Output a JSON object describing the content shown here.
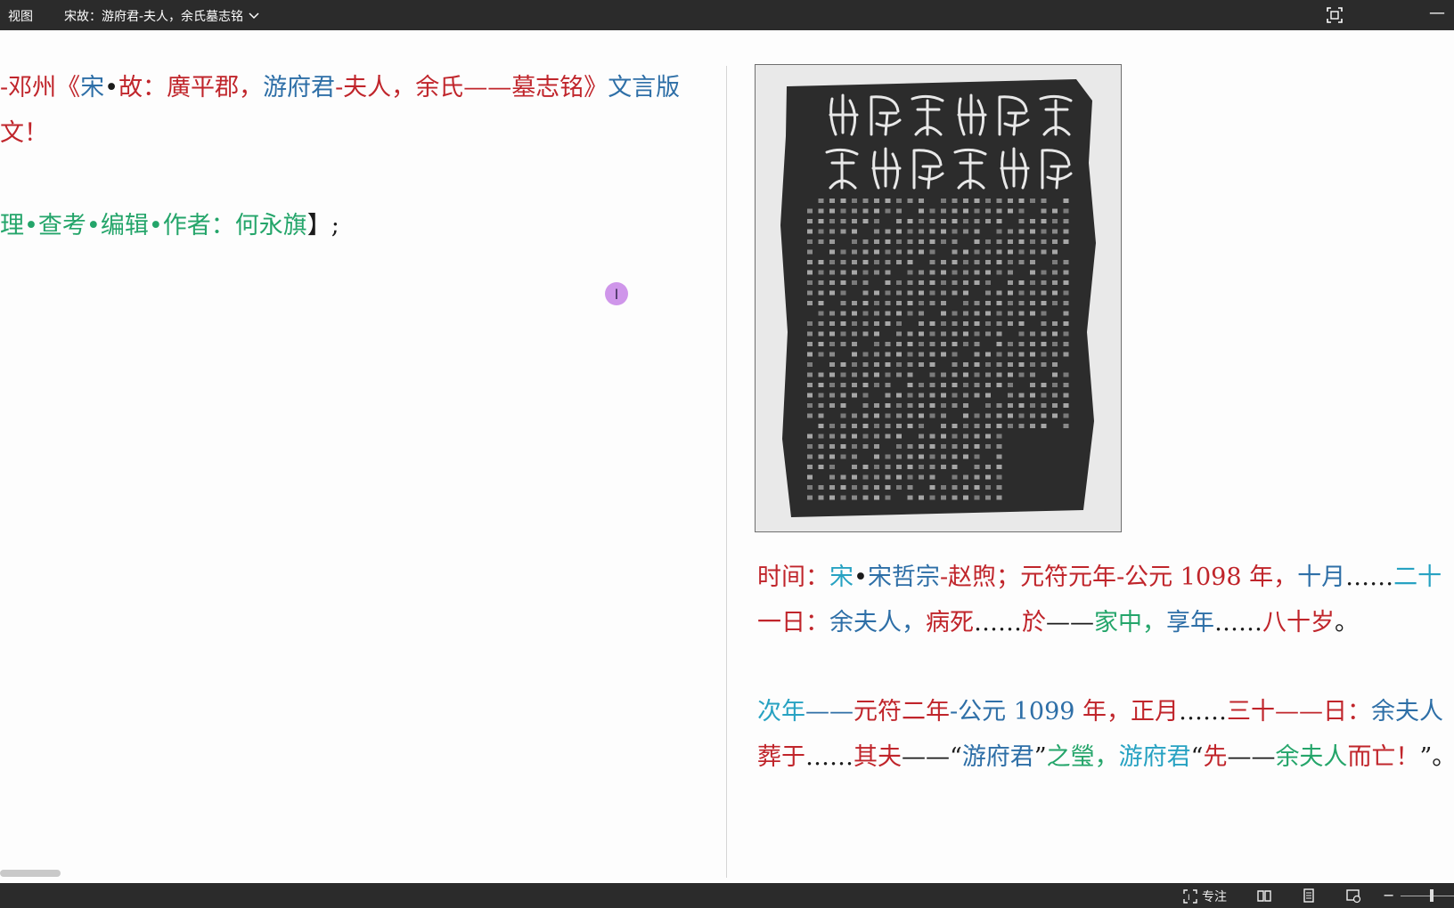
{
  "titlebar": {
    "view_menu": "视图",
    "doc_title": "宋故：游府君-夫人，余氏墓志铭"
  },
  "left_text": {
    "line1": [
      {
        "t": "-邓州《",
        "c": "red"
      },
      {
        "t": "宋",
        "c": "blue"
      },
      {
        "t": "•",
        "c": "dark"
      },
      {
        "t": "故：",
        "c": "red"
      },
      {
        "t": "廣平郡，",
        "c": "red"
      },
      {
        "t": "游府君",
        "c": "blue"
      },
      {
        "t": "-夫人，",
        "c": "red"
      },
      {
        "t": "余氏",
        "c": "red"
      },
      {
        "t": "——墓志铭》",
        "c": "red"
      },
      {
        "t": "文言版",
        "c": "blue"
      }
    ],
    "line2": [
      {
        "t": "文！",
        "c": "red"
      }
    ],
    "line3": [
      {
        "t": "理•查考•编辑•作者：何永旗",
        "c": "green"
      },
      {
        "t": "】;",
        "c": "dark"
      }
    ]
  },
  "right_text": {
    "line1": [
      {
        "t": "时间：",
        "c": "red"
      },
      {
        "t": "宋",
        "c": "teal"
      },
      {
        "t": "•",
        "c": "dark"
      },
      {
        "t": "宋哲宗",
        "c": "blue"
      },
      {
        "t": "-赵煦；",
        "c": "red"
      },
      {
        "t": "元符元年",
        "c": "red"
      },
      {
        "t": "-公元 ",
        "c": "red"
      },
      {
        "t": "1098",
        "c": "red"
      },
      {
        "t": " 年，",
        "c": "red"
      },
      {
        "t": "十月",
        "c": "blue"
      },
      {
        "t": "……",
        "c": "dark"
      },
      {
        "t": "二十",
        "c": "teal"
      }
    ],
    "line2": [
      {
        "t": "一日：",
        "c": "red"
      },
      {
        "t": "余夫人，",
        "c": "blue"
      },
      {
        "t": "病死",
        "c": "red"
      },
      {
        "t": "……",
        "c": "dark"
      },
      {
        "t": "於",
        "c": "red"
      },
      {
        "t": "——",
        "c": "dark"
      },
      {
        "t": "家中，",
        "c": "green"
      },
      {
        "t": "享年",
        "c": "blue"
      },
      {
        "t": "……",
        "c": "dark"
      },
      {
        "t": "八十岁",
        "c": "red"
      },
      {
        "t": "。",
        "c": "dark"
      }
    ],
    "line3": [
      {
        "t": "次年",
        "c": "teal"
      },
      {
        "t": "——",
        "c": "blue"
      },
      {
        "t": "元符二年",
        "c": "red"
      },
      {
        "t": "-公元 ",
        "c": "blue"
      },
      {
        "t": "1099",
        "c": "blue"
      },
      {
        "t": " 年，",
        "c": "red"
      },
      {
        "t": "正月",
        "c": "red"
      },
      {
        "t": "……",
        "c": "dark"
      },
      {
        "t": "三十",
        "c": "red"
      },
      {
        "t": "——",
        "c": "red"
      },
      {
        "t": "日：",
        "c": "red"
      },
      {
        "t": "余夫人",
        "c": "blue"
      }
    ],
    "line4": [
      {
        "t": "葬于",
        "c": "red"
      },
      {
        "t": "……",
        "c": "dark"
      },
      {
        "t": "其夫",
        "c": "red"
      },
      {
        "t": "——“",
        "c": "dark"
      },
      {
        "t": "游府君",
        "c": "blue"
      },
      {
        "t": "”",
        "c": "dark"
      },
      {
        "t": "之瑩，",
        "c": "green"
      },
      {
        "t": "游府君",
        "c": "teal"
      },
      {
        "t": "“",
        "c": "dark"
      },
      {
        "t": "先",
        "c": "red"
      },
      {
        "t": "——",
        "c": "dark"
      },
      {
        "t": "余夫人",
        "c": "green"
      },
      {
        "t": "而亡！",
        "c": "red"
      },
      {
        "t": "”。",
        "c": "dark"
      }
    ]
  },
  "rubbing": {
    "seal_title": [
      "宋故",
      "游府",
      "君夫",
      "人摄",
      "氏墓",
      "誌銘"
    ]
  },
  "statusbar": {
    "focus_label": "专注"
  },
  "colors": {
    "red": "#c0252b",
    "blue": "#2e6fa7",
    "teal": "#27a2c2",
    "green": "#24a56a",
    "dark": "#1b1b1b"
  }
}
